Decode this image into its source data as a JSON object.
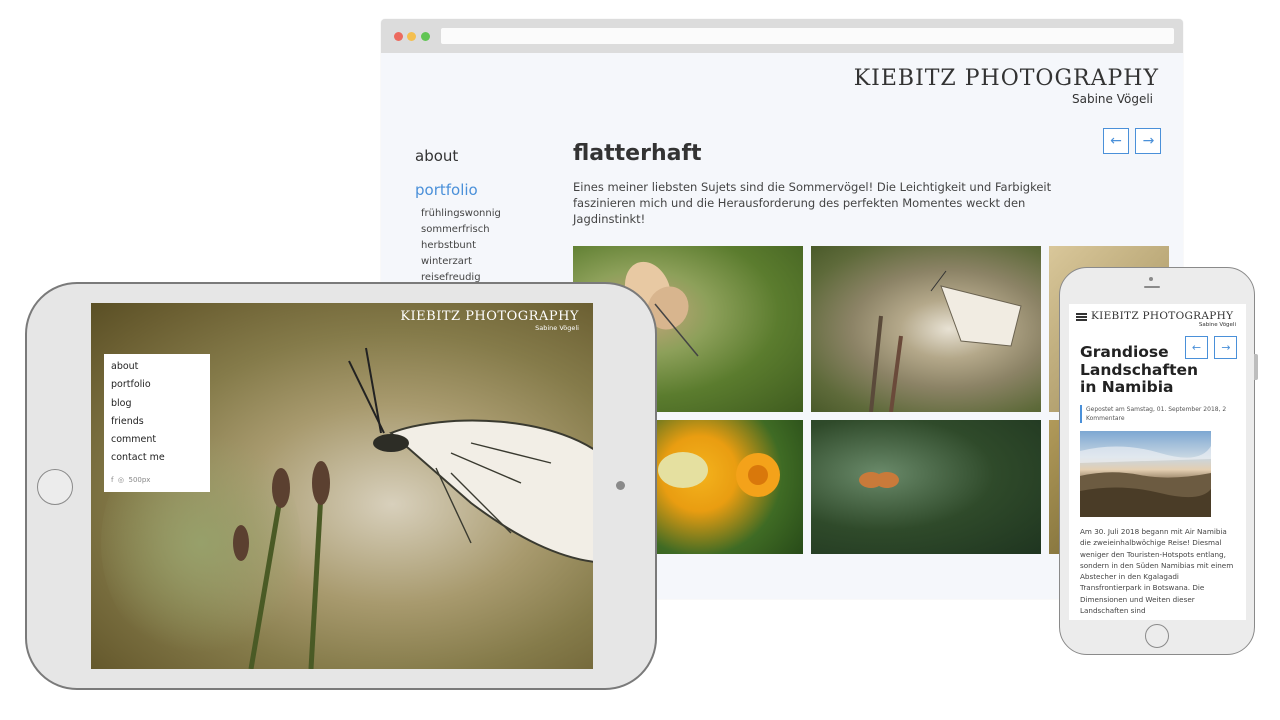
{
  "desktop": {
    "brand": "KIEBITZ PHOTOGRAPHY",
    "subtitle": "Sabine Vögeli",
    "nav": {
      "about": "about",
      "portfolio": "portfolio",
      "subitems": [
        "frühlingswonnig",
        "sommerfrisch",
        "herbstbunt",
        "winterzart",
        "reisefreudig"
      ]
    },
    "arrows": {
      "prev": "←",
      "next": "→"
    },
    "title": "flatterhaft",
    "description": "Eines meiner liebsten Sujets sind die Sommervögel! Die Leichtigkeit und Farbigkeit faszinieren mich und die Herausforderung des perfekten Momentes weckt den Jagdinstinkt!"
  },
  "tablet": {
    "brand": "KIEBITZ PHOTOGRAPHY",
    "subtitle": "Sabine Vögeli",
    "menu": [
      "about",
      "portfolio",
      "blog",
      "friends",
      "comment",
      "contact me"
    ],
    "social": {
      "facebook": "f",
      "instagram": "◎",
      "fivehundred": "500px"
    }
  },
  "phone": {
    "brand": "KIEBITZ PHOTOGRAPHY",
    "subtitle": "Sabine Vögeli",
    "arrows": {
      "prev": "←",
      "next": "→"
    },
    "title": "Grandiose Landschaften in Namibia",
    "meta": "Gepostet am Samstag, 01. September 2018, 2 Kommentare",
    "body": "Am 30. Juli 2018 begann mit Air Namibia die zweieinhalbwöchige Reise! Diesmal weniger den Touristen-Hotspots entlang, sondern in den Süden Namibias mit einem Abstecher in den Kgalagadi Transfrontierpark in Botswana. Die Dimensionen und Weiten dieser Landschaften sind"
  },
  "colors": {
    "accent": "#4a90d9",
    "text": "#333333",
    "page_bg": "#f5f7fb"
  }
}
